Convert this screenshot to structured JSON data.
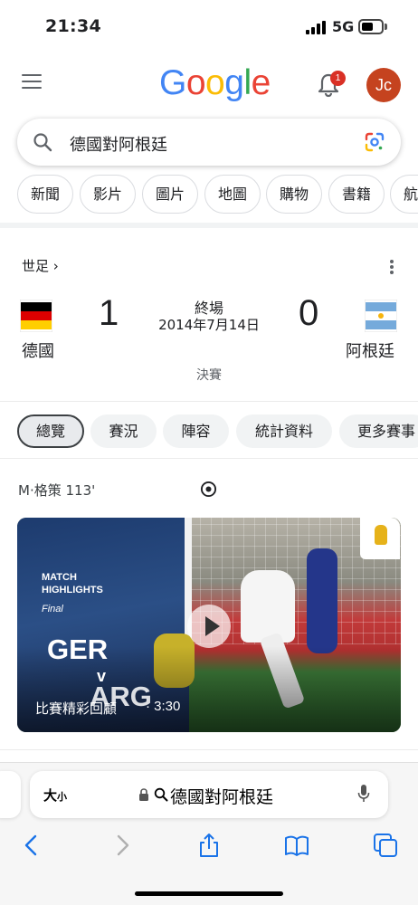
{
  "status_bar": {
    "time": "21:34",
    "network": "5G"
  },
  "header": {
    "logo_letters": [
      "G",
      "o",
      "o",
      "g",
      "l",
      "e"
    ],
    "notification_count": "1",
    "avatar_initials": "Jc",
    "icons": {
      "menu": "menu-icon",
      "bell": "bell-icon"
    }
  },
  "search": {
    "query": "德國對阿根廷",
    "icons": [
      "search-icon",
      "google-lens-icon"
    ]
  },
  "chips": [
    "新聞",
    "影片",
    "圖片",
    "地圖",
    "購物",
    "書籍",
    "航"
  ],
  "sports_card": {
    "section_title": "世足 ›",
    "home_team": {
      "name": "德國",
      "score": "1",
      "flag": "germany-flag"
    },
    "away_team": {
      "name": "阿根廷",
      "score": "0",
      "flag": "argentina-flag"
    },
    "status": "終場",
    "date": "2014年7月14日",
    "round": "決賽",
    "tabs": [
      "總覽",
      "賽況",
      "陣容",
      "統計資料",
      "更多賽事"
    ],
    "active_tab": "總覽",
    "event": {
      "text": "M·格策 113'",
      "icon": "soccer-ball-icon"
    },
    "video": {
      "overlay_title_line1": "MATCH",
      "overlay_title_line2": "HIGHLIGHTS",
      "overlay_subtitle": "Final",
      "overlay_team1": "GER",
      "overlay_vs": "v",
      "overlay_team2": "ARG",
      "caption": "比賽精彩回顧",
      "duration": "· 3:30"
    }
  },
  "safari": {
    "text_size_label": "大",
    "text_size_small": "小",
    "url_text": "德國對阿根廷",
    "toolbar": [
      "back-icon",
      "forward-icon",
      "share-icon",
      "bookmarks-icon",
      "tabs-icon"
    ]
  }
}
